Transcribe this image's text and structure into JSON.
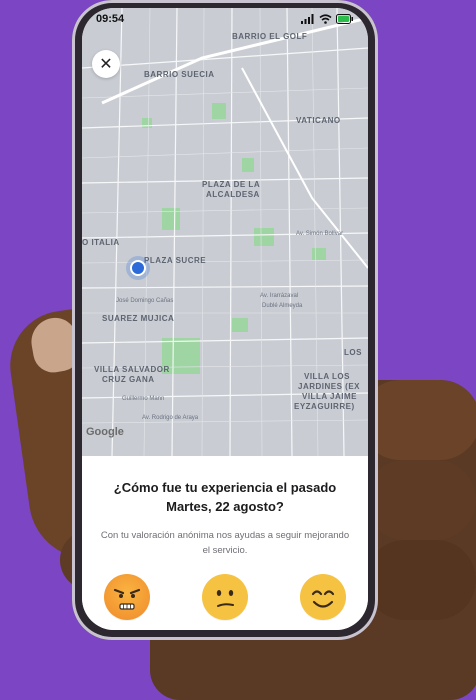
{
  "status_bar": {
    "time": "09:54"
  },
  "map": {
    "labels": [
      "BARRIO EL GOLF",
      "BARRIO SUECIA",
      "VATICANO",
      "PLAZA DE LA",
      "ALCALDESA",
      "O ITALIA",
      "PLAZA SUCRE",
      "SUAREZ MUJICA",
      "VILLA SALVADOR",
      "CRUZ GANA",
      "VILLA LOS",
      "JARDINES (EX",
      "VILLA JAIME",
      "EYZAGUIRRE)",
      "LOS"
    ],
    "streets": [
      "José Domingo Cañas",
      "Av. Irarrázaval",
      "Dublé Almeyda",
      "Av. Simón Bolívar",
      "Guillermo Mann",
      "Av. Rodrigo de Araya"
    ],
    "attribution": "Google"
  },
  "rating": {
    "question": "¿Cómo fue tu experiencia el pasado Martes, 22 agosto?",
    "subtitle": "Con tu valoración anónima nos ayudas a seguir mejorando el servicio.",
    "options": [
      "angry-face-icon",
      "neutral-face-icon",
      "smiling-face-icon"
    ]
  },
  "colors": {
    "background": "#7b45c4",
    "accent_face": "#f6c241",
    "location_dot": "#2b6ad8"
  }
}
